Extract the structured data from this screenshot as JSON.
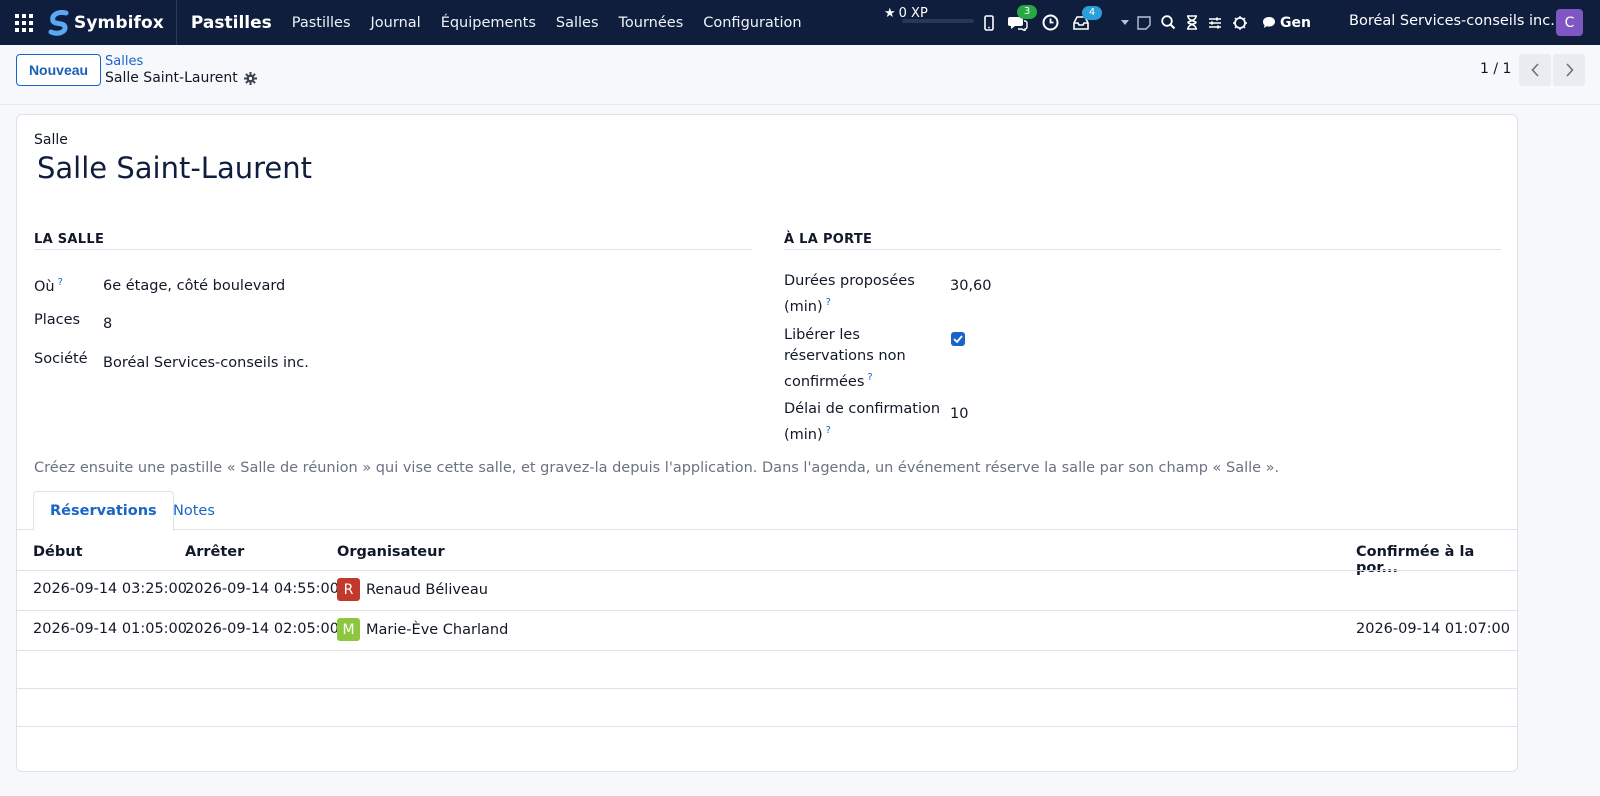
{
  "navbar": {
    "brand": "Symbifox",
    "app_name": "Pastilles",
    "menu": [
      "Pastilles",
      "Journal",
      "Équipements",
      "Salles",
      "Tournées",
      "Configuration"
    ],
    "xp": "0 XP",
    "messages_count": "3",
    "activities_count": "4",
    "gen_label": "Gen",
    "company": "Boréal Services-conseils inc.",
    "avatar_letter": "C",
    "avatar_color": "#7e57c2"
  },
  "control": {
    "new_button": "Nouveau",
    "breadcrumb_parent": "Salles",
    "breadcrumb_current": "Salle Saint-Laurent",
    "pager": "1 / 1"
  },
  "form": {
    "record_label": "Salle",
    "title": "Salle Saint-Laurent",
    "left_section": {
      "title": "LA SALLE",
      "fields": [
        {
          "label": "Où",
          "value": "6e étage, côté boulevard"
        },
        {
          "label": "Places",
          "value": "8"
        },
        {
          "label": "Société",
          "value": "Boréal Services-conseils inc."
        }
      ]
    },
    "right_section": {
      "title": "À LA PORTE",
      "durations_label_1": "Durées proposées",
      "durations_label_2": "(min)",
      "durations_value": "30,60",
      "release_label_1": "Libérer les",
      "release_label_2": "réservations non",
      "release_label_3": "confirmées",
      "release_checked": true,
      "delay_label_1": "Délai de confirmation",
      "delay_label_2": "(min)",
      "delay_value": "10"
    },
    "help_marker": "?",
    "help_text": "Créez ensuite une pastille « Salle de réunion » qui vise cette salle, et gravez-la depuis l'application. Dans l'agenda, un événement réserve la salle par son champ « Salle »."
  },
  "tabs": [
    "Réservations",
    "Notes"
  ],
  "table": {
    "columns": [
      "Début",
      "Arrêter",
      "Organisateur",
      "Confirmée à la por..."
    ],
    "rows": [
      {
        "start": "2026-09-14 03:25:00",
        "stop": "2026-09-14 04:55:00",
        "initial": "R",
        "organizer": "Renaud Béliveau",
        "color": "#c0392b",
        "confirmed": ""
      },
      {
        "start": "2026-09-14 01:05:00",
        "stop": "2026-09-14 02:05:00",
        "initial": "M",
        "organizer": "Marie-Ève Charland",
        "color": "#8dc63f",
        "confirmed": "2026-09-14 01:07:00"
      }
    ]
  }
}
